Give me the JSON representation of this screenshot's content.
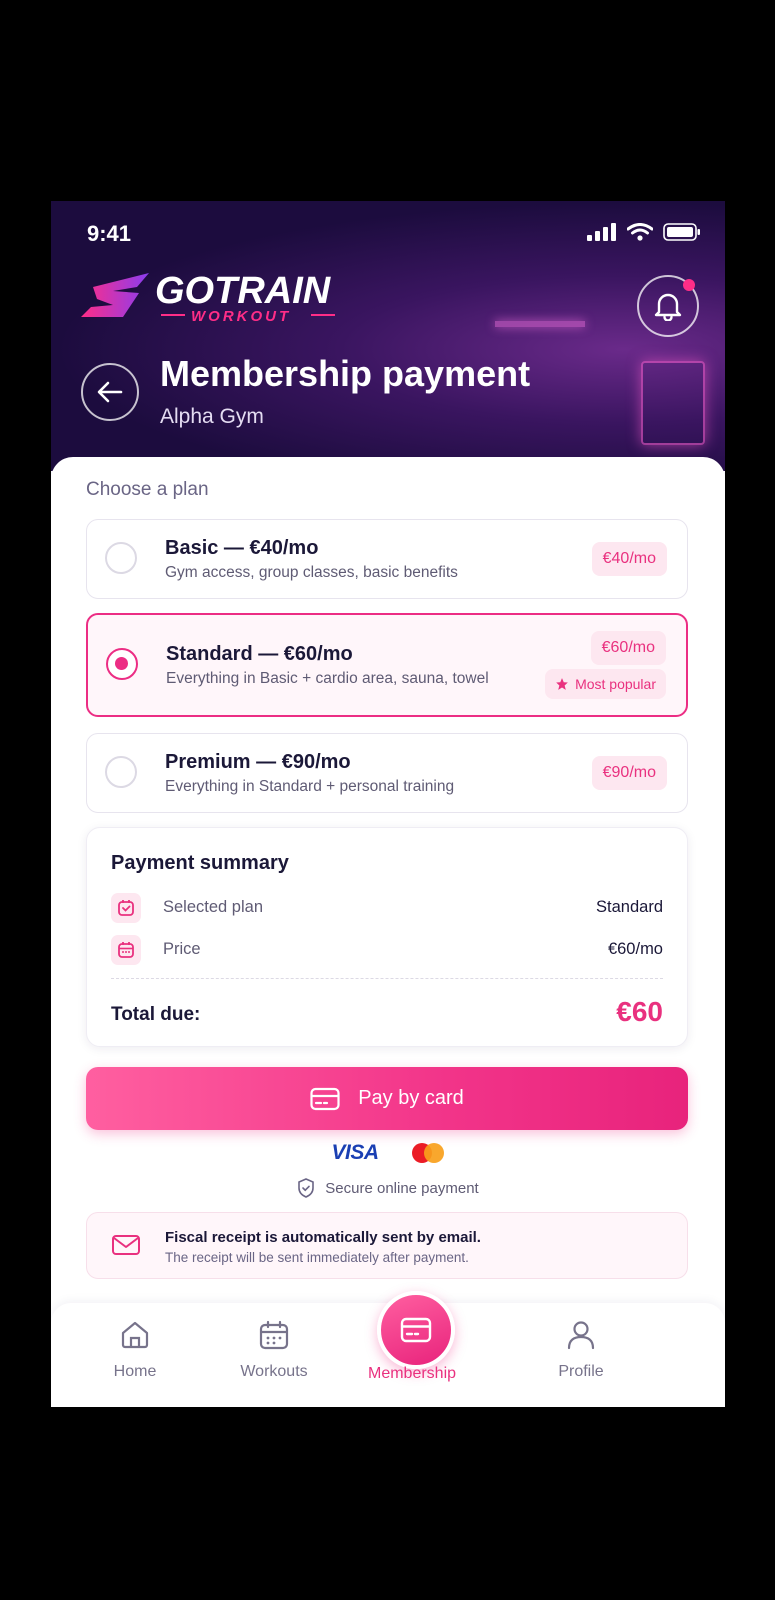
{
  "status": {
    "time": "9:41"
  },
  "brand": {
    "name": "GOTRAIN",
    "tagline": "WORKOUT"
  },
  "header": {
    "title": "Membership payment",
    "subtitle": "Alpha Gym"
  },
  "plans": {
    "label": "Choose a plan",
    "items": [
      {
        "name": "Basic — €40/mo",
        "description": "Gym access, group classes, basic benefits",
        "price": "€40/mo",
        "selected": false
      },
      {
        "name": "Standard — €60/mo",
        "description": "Everything in Basic + cardio area, sauna, towel",
        "price": "€60/mo",
        "badge": "Most popular",
        "selected": true
      },
      {
        "name": "Premium — €90/mo",
        "description": "Everything in Standard + personal training",
        "price": "€90/mo",
        "selected": false
      }
    ]
  },
  "summary": {
    "title": "Payment summary",
    "rows": [
      {
        "label": "Selected plan",
        "value": "Standard",
        "icon": "calendar-check-icon"
      },
      {
        "label": "Price",
        "value": "€60/mo",
        "icon": "calendar-icon"
      }
    ],
    "total_label": "Total due:",
    "total_value": "€60"
  },
  "pay": {
    "label": "Pay by card",
    "visa": "VISA",
    "secure": "Secure online payment"
  },
  "receipt": {
    "title": "Fiscal receipt is automatically sent by email.",
    "subtitle": "The receipt will be sent immediately after payment."
  },
  "nav": {
    "items": [
      {
        "label": "Home",
        "icon": "home-icon"
      },
      {
        "label": "Workouts",
        "icon": "calendar-icon"
      },
      {
        "label": "Membership",
        "icon": "card-icon",
        "active": true
      },
      {
        "label": "Profile",
        "icon": "user-icon"
      }
    ]
  },
  "colors": {
    "accent": "#ec2d84",
    "header": "#1c0c3e",
    "text": "#1b1838"
  }
}
